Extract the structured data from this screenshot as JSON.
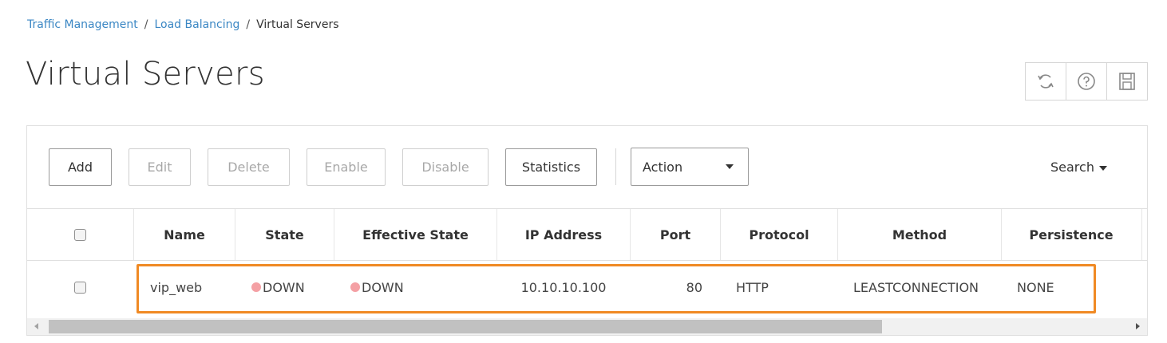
{
  "breadcrumb": {
    "items": [
      "Traffic Management",
      "Load Balancing"
    ],
    "separator": "/",
    "current": "Virtual Servers"
  },
  "page_title": "Virtual Servers",
  "page_icons": [
    "refresh-icon",
    "help-icon",
    "save-icon"
  ],
  "toolbar": {
    "add": "Add",
    "edit": "Edit",
    "delete": "Delete",
    "enable": "Enable",
    "disable": "Disable",
    "statistics": "Statistics",
    "action_select": "Action",
    "search": "Search"
  },
  "table": {
    "columns": [
      "Name",
      "State",
      "Effective State",
      "IP Address",
      "Port",
      "Protocol",
      "Method",
      "Persistence"
    ],
    "rows": [
      {
        "name": "vip_web",
        "state": "DOWN",
        "effective_state": "DOWN",
        "ip_address": "10.10.10.100",
        "port": "80",
        "protocol": "HTTP",
        "method": "LEASTCONNECTION",
        "persistence": "NONE"
      }
    ]
  },
  "colors": {
    "link": "#3b87c4",
    "status_down": "#f4a0a4",
    "highlight": "#f08a24"
  }
}
